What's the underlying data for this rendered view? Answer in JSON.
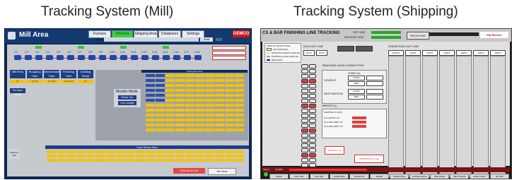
{
  "headings": {
    "left": "Tracking System (Mill)",
    "right": "Tracking System (Shipping)"
  },
  "mill": {
    "title": "Mill Area",
    "nav": [
      "Furnace Area",
      "Mill Area",
      "Shipping Area",
      "Databases",
      "Settings"
    ],
    "active_nav": "Mill Area",
    "brand": "GEMCO",
    "shift": "Shift",
    "stands": [
      "C1",
      "C2",
      "C3",
      "C4",
      "C5",
      "C6",
      "C7",
      "C8",
      "C9",
      "C10",
      "C11",
      "C12",
      "C13",
      "C14",
      "C15",
      "C16",
      "C17",
      "C18"
    ],
    "zones": [
      {
        "name": "Mill Entry",
        "value": "21"
      },
      {
        "name": "Roughing Train",
        "value": "C1-C6"
      },
      {
        "name": "Intermediate Train",
        "value": "C7-C12"
      },
      {
        "name": "Finishing Train",
        "value": "C13-C18"
      },
      {
        "name": "Dividing Shear",
        "value": "21"
      }
    ],
    "cooling_bed_title": "Cooling Bed Area",
    "cold_shear_title": "Cold Shear Area",
    "monitor_mode": {
      "label": "Monitor Mode",
      "buttons": [
        "Shear No.",
        "Cut Length"
      ]
    },
    "shipping_label": "Shipping Area",
    "buttons": {
      "edit_mode": "Edit Mode ON",
      "all_clear": "All Clear"
    },
    "furnace_label": "Furnace Area"
  },
  "ship": {
    "title": "CS & BAR FINISHING LINE TRACKING",
    "set_size_label": "SET SIZE",
    "receive_size_label": "RECEIVE SIZE",
    "receiving": "RECEIVING",
    "brand": "Pal Electric",
    "legend": [
      "LIMIT OF VALUE IS (No)",
      "NOT EXISTING",
      "EXISTING (SHORT LENGTH)",
      "EXISTING (LONG LENGTH)",
      "HEAT END"
    ],
    "run_out_line": "RUN OUT LINE",
    "rot_labels": [
      "ROT1",
      "ROT2"
    ],
    "tracking_conn": "TRACKING DATA CONNECTION",
    "source_label": "SOURCE",
    "destination_label": "DESTINATION",
    "zone_label": "ZONE No.",
    "start": "START",
    "end": "END",
    "weight_label": "WEIGHT (t)",
    "shipping_cv": "SHIPPING CV (FX)",
    "entry_labels": [
      "No.1 ENTRY FX",
      "No.1 DELIVERY FX",
      "No.2 DELIVERY FX"
    ],
    "shear_run_out": "SHEAR RUN OUT LINE",
    "cols": [
      "1ESRT1",
      "1SFS2",
      "2SRT1",
      "2SRT2",
      "2SRT3",
      "2SRT4",
      "2SRT5"
    ],
    "finishing_label": "FINISHING TO LINE",
    "ship_to_label": "SHIPPING TO",
    "bottom_buttons": [
      "MENU",
      "MILL SET",
      "AUX SET",
      "OVERVIEW",
      "MONITOR",
      "MODE",
      "OPERATION",
      "CONVEYANCE",
      "PRE PAGE",
      "NEXT PAGE",
      "HARD COPY",
      "RC SET"
    ],
    "alarm": "ALARM",
    "server": "Server"
  }
}
